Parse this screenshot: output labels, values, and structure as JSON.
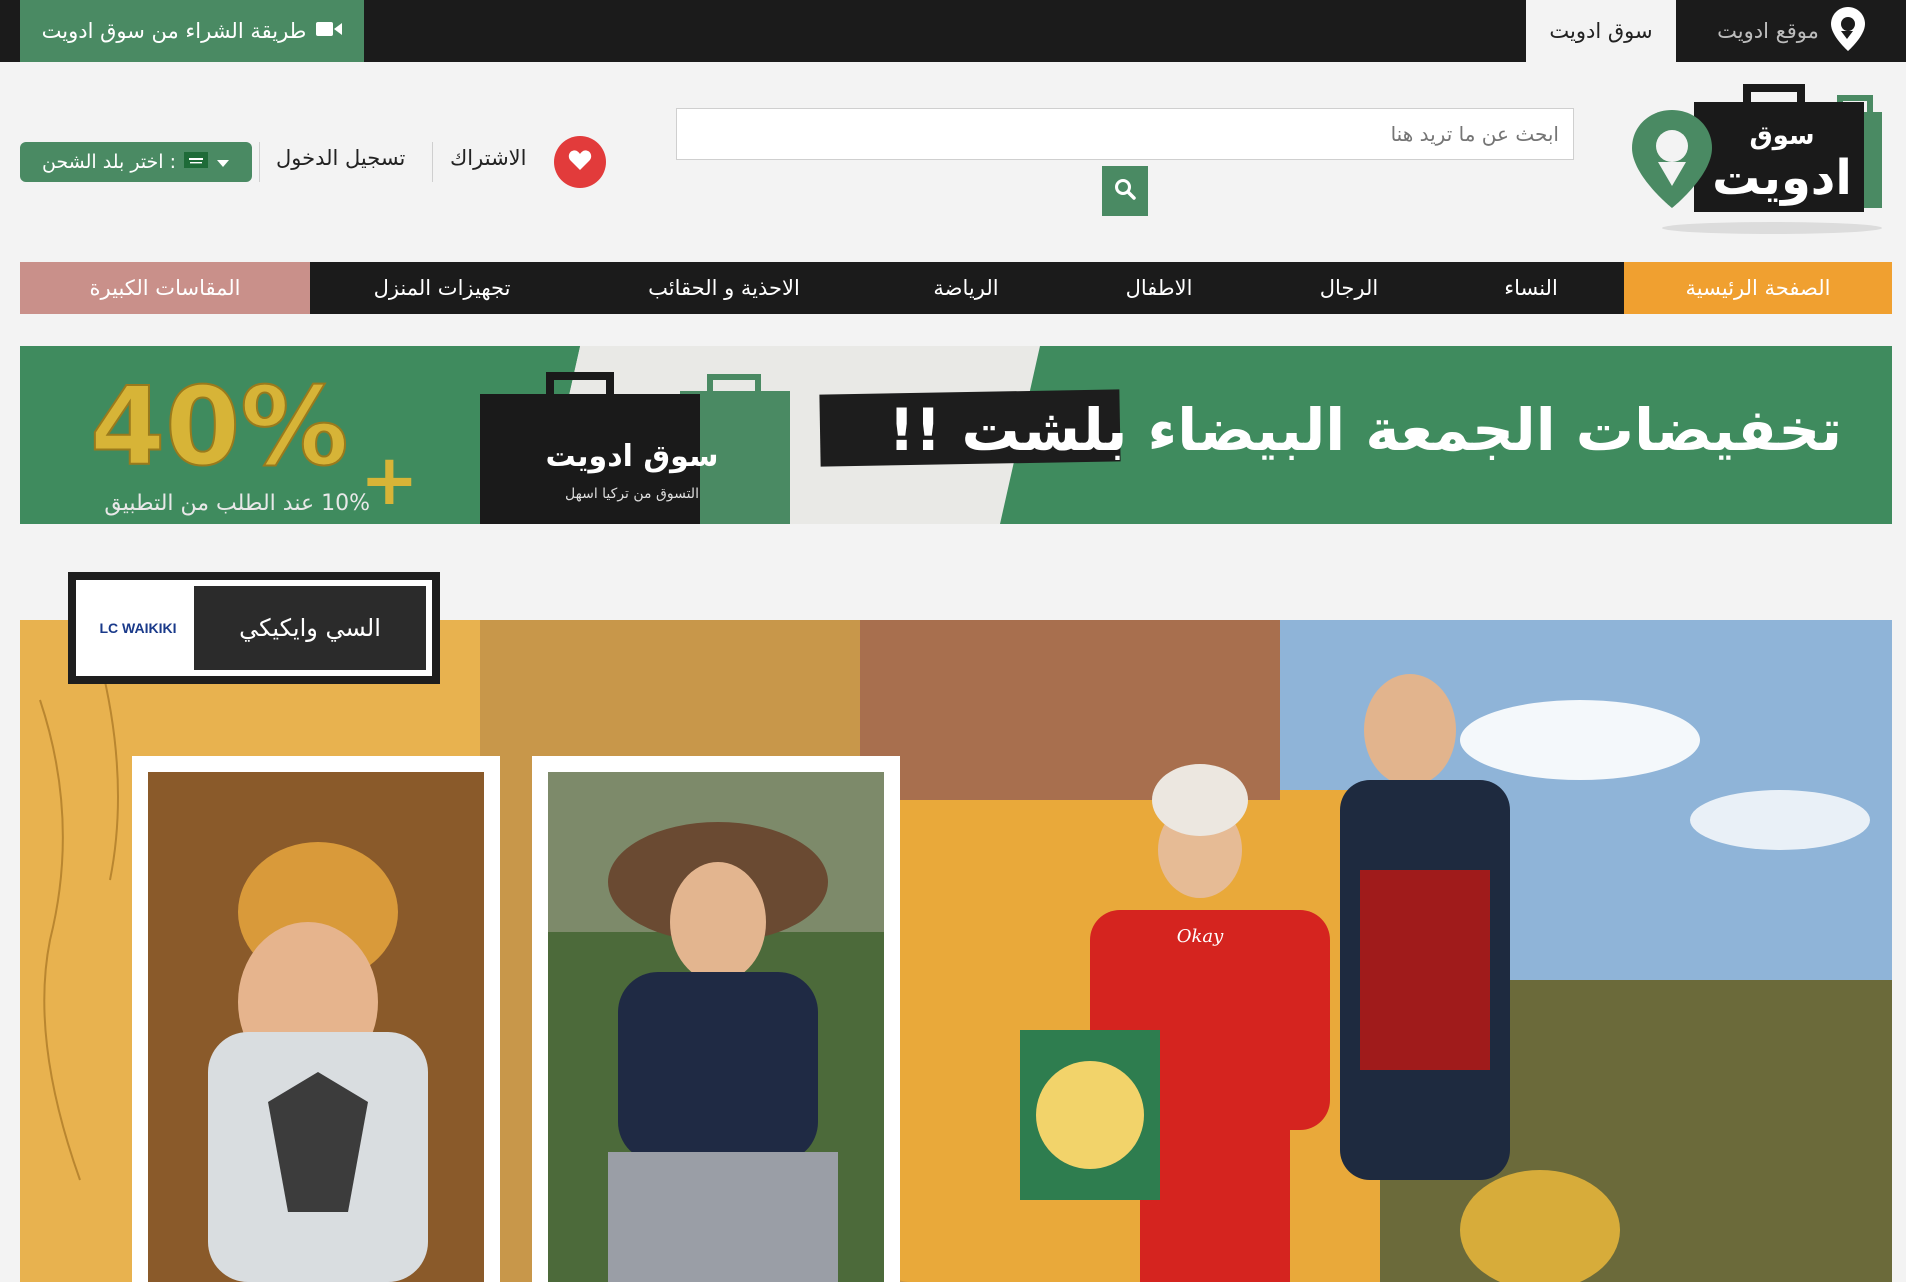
{
  "topbar": {
    "howto_label": "طريقة الشراء من سوق ادويت",
    "tab_souq": "سوق ادويت",
    "tab_site": "موقع ادويت"
  },
  "logo": {
    "line1": "سوق",
    "line2": "ادويت"
  },
  "search": {
    "placeholder": "ابحث عن ما تريد هنا"
  },
  "header": {
    "subscribe": "الاشتراك",
    "login": "تسجيل الدخول",
    "ship_country": "اختر بلد الشحن :"
  },
  "nav": {
    "items": [
      "الصفحة الرئيسية",
      "النساء",
      "الرجال",
      "الاطفال",
      "الرياضة",
      "الاحذية و الحقائب",
      "تجهيزات المنزل",
      "المقاسات الكبيرة"
    ]
  },
  "promo": {
    "headline": "تخفيضات الجمعة البيضاء بلشت !!",
    "bag_brand": "سوق ادويت",
    "bag_tagline": "التسوق من تركيا اسهل",
    "discount": "40%",
    "plus": "+",
    "app_offer": "10% عند الطلب من التطبيق"
  },
  "hero": {
    "brand_name": "السي وايكيكي",
    "brand_logo_text": "LC WAIKIKI",
    "shirt_text": "Okay"
  },
  "colors": {
    "green": "#4a8a63",
    "orange": "#f0a030",
    "nav_dark": "#1b1b1b",
    "pink": "#c9908a",
    "heart_red": "#e23b3b"
  }
}
